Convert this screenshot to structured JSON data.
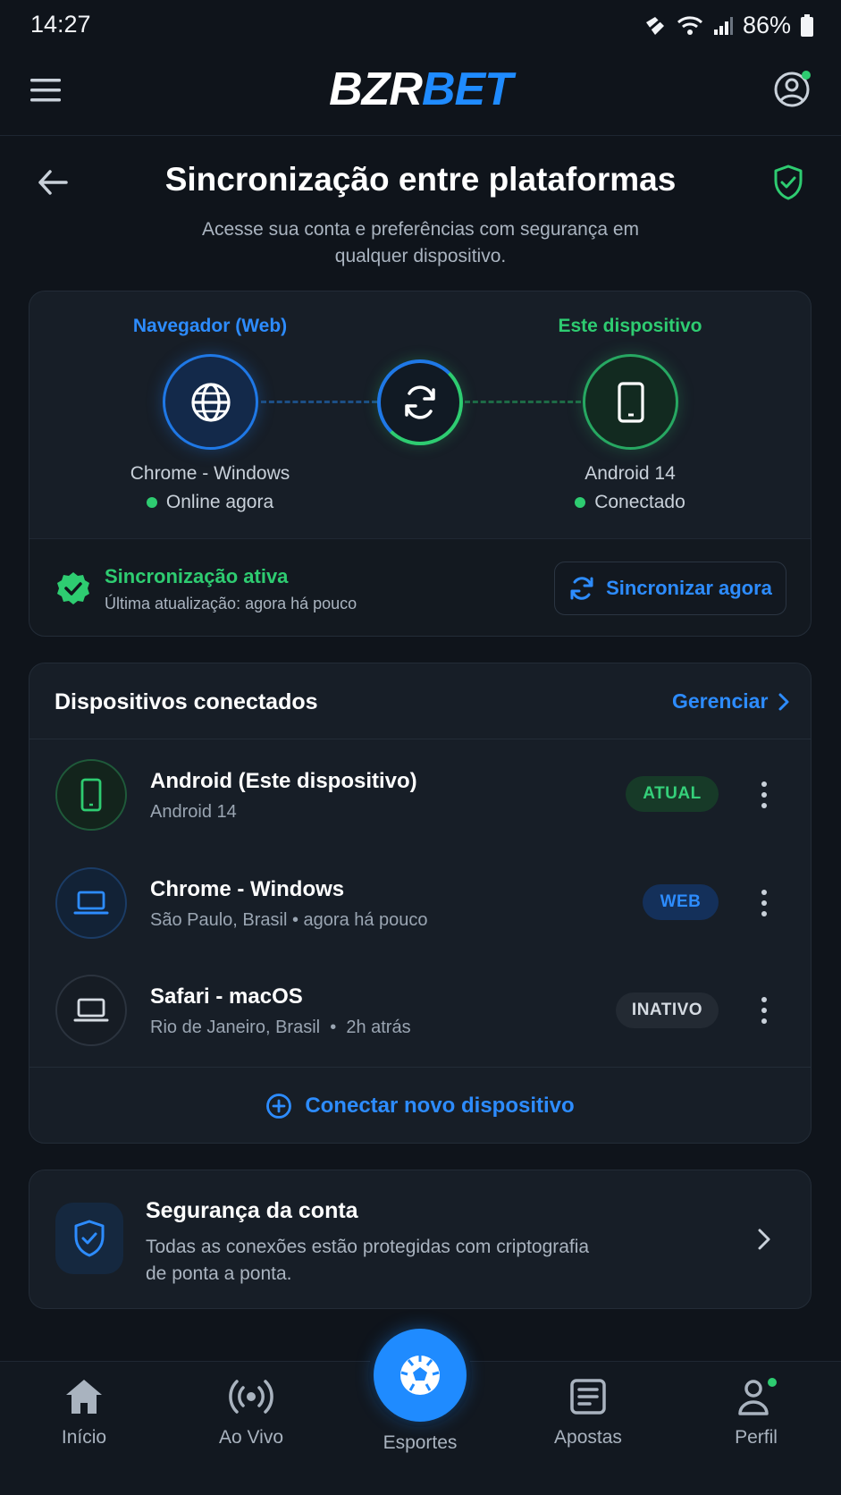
{
  "status": {
    "time": "14:27",
    "battery": "86%"
  },
  "app": {
    "logo_part1": "BZR",
    "logo_part2": "BET",
    "accent": "#1f8bff",
    "success": "#2ecc71"
  },
  "header": {
    "title": "Sincronização entre plataformas",
    "subtitle": "Acesse sua conta e preferências com segurança em qualquer dispositivo."
  },
  "sync": {
    "left": {
      "label": "Navegador (Web)",
      "name": "Chrome - Windows",
      "status": "Online agora",
      "icon": "globe-icon"
    },
    "right": {
      "label": "Este dispositivo",
      "name": "Android 14",
      "status": "Conectado",
      "icon": "smartphone-icon"
    },
    "state_title": "Sincronização ativa",
    "state_sub": "Última atualização: agora há pouco",
    "sync_button": "Sincronizar agora"
  },
  "devices": {
    "title": "Dispositivos conectados",
    "manage": "Gerenciar",
    "items": [
      {
        "name": "Android (Este dispositivo)",
        "sub": "Android 14",
        "badge": "ATUAL",
        "icon": "smartphone-icon"
      },
      {
        "name": "Chrome - Windows",
        "sub": "São Paulo, Brasil • agora há pouco",
        "badge": "WEB",
        "icon": "laptop-icon"
      },
      {
        "name": "Safari - macOS",
        "sub": "Rio de Janeiro, Brasil  •  2h atrás",
        "badge": "INATIVO",
        "icon": "laptop-icon"
      }
    ],
    "connect": "Conectar novo dispositivo"
  },
  "security": {
    "title": "Segurança da conta",
    "text_line1": "Todas as conexões estão protegidas com criptografia",
    "text_line2": "de ponta a ponta."
  },
  "nav": {
    "items": [
      {
        "label": "Início",
        "icon": "home-icon"
      },
      {
        "label": "Ao Vivo",
        "icon": "live-icon"
      },
      {
        "label": "Esportes",
        "icon": "soccer-ball-icon"
      },
      {
        "label": "Apostas",
        "icon": "bets-icon"
      },
      {
        "label": "Perfil",
        "icon": "profile-icon"
      }
    ]
  }
}
